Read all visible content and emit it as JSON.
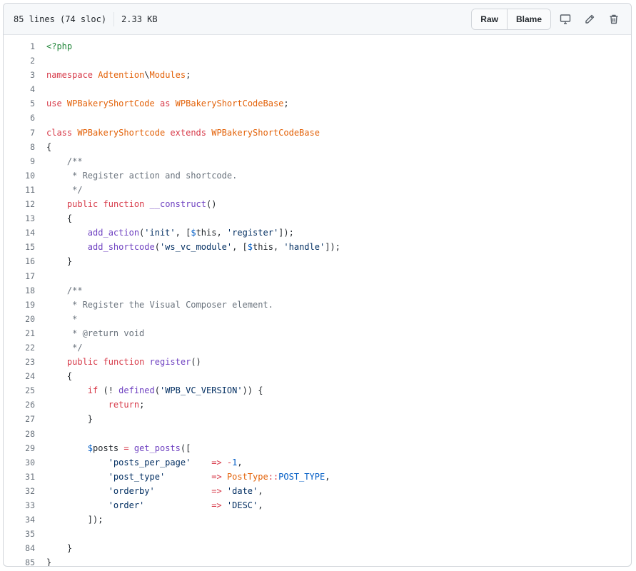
{
  "header": {
    "lines_info": "85 lines (74 sloc)",
    "size": "2.33 KB",
    "raw_label": "Raw",
    "blame_label": "Blame"
  },
  "icons": {
    "display": "desktop-icon",
    "edit": "pencil-icon",
    "delete": "trash-icon"
  },
  "code_lines": [
    {
      "n": "1",
      "t": [
        [
          "g",
          "<?php"
        ]
      ]
    },
    {
      "n": "2",
      "t": []
    },
    {
      "n": "3",
      "t": [
        [
          "k",
          "namespace"
        ],
        [
          "tx",
          " "
        ],
        [
          "e",
          "Adtention"
        ],
        [
          "tx",
          "\\"
        ],
        [
          "e",
          "Modules"
        ],
        [
          "tx",
          ";"
        ]
      ]
    },
    {
      "n": "4",
      "t": []
    },
    {
      "n": "5",
      "t": [
        [
          "k",
          "use"
        ],
        [
          "tx",
          " "
        ],
        [
          "e",
          "WPBakeryShortCode"
        ],
        [
          "tx",
          " "
        ],
        [
          "k",
          "as"
        ],
        [
          "tx",
          " "
        ],
        [
          "e",
          "WPBakeryShortCodeBase"
        ],
        [
          "tx",
          ";"
        ]
      ]
    },
    {
      "n": "6",
      "t": []
    },
    {
      "n": "7",
      "t": [
        [
          "k",
          "class"
        ],
        [
          "tx",
          " "
        ],
        [
          "e",
          "WPBakeryShortcode"
        ],
        [
          "tx",
          " "
        ],
        [
          "k",
          "extends"
        ],
        [
          "tx",
          " "
        ],
        [
          "e",
          "WPBakeryShortCodeBase"
        ]
      ]
    },
    {
      "n": "8",
      "t": [
        [
          "tx",
          "{"
        ]
      ]
    },
    {
      "n": "9",
      "t": [
        [
          "tx",
          "    "
        ],
        [
          "c",
          "/**"
        ]
      ]
    },
    {
      "n": "10",
      "t": [
        [
          "c",
          "     * Register action and shortcode."
        ]
      ]
    },
    {
      "n": "11",
      "t": [
        [
          "c",
          "     */"
        ]
      ]
    },
    {
      "n": "12",
      "t": [
        [
          "tx",
          "    "
        ],
        [
          "k",
          "public"
        ],
        [
          "tx",
          " "
        ],
        [
          "k",
          "function"
        ],
        [
          "tx",
          " "
        ],
        [
          "f",
          "__construct"
        ],
        [
          "tx",
          "()"
        ]
      ]
    },
    {
      "n": "13",
      "t": [
        [
          "tx",
          "    {"
        ]
      ]
    },
    {
      "n": "14",
      "t": [
        [
          "tx",
          "        "
        ],
        [
          "f",
          "add_action"
        ],
        [
          "tx",
          "("
        ],
        [
          "s",
          "'init'"
        ],
        [
          "tx",
          ", ["
        ],
        [
          "v",
          "$"
        ],
        [
          "tx",
          "this, "
        ],
        [
          "s",
          "'register'"
        ],
        [
          "tx",
          "]);"
        ]
      ]
    },
    {
      "n": "15",
      "t": [
        [
          "tx",
          "        "
        ],
        [
          "f",
          "add_shortcode"
        ],
        [
          "tx",
          "("
        ],
        [
          "s",
          "'ws_vc_module'"
        ],
        [
          "tx",
          ", ["
        ],
        [
          "v",
          "$"
        ],
        [
          "tx",
          "this, "
        ],
        [
          "s",
          "'handle'"
        ],
        [
          "tx",
          "]);"
        ]
      ]
    },
    {
      "n": "16",
      "t": [
        [
          "tx",
          "    }"
        ]
      ]
    },
    {
      "n": "17",
      "t": []
    },
    {
      "n": "18",
      "t": [
        [
          "tx",
          "    "
        ],
        [
          "c",
          "/**"
        ]
      ]
    },
    {
      "n": "19",
      "t": [
        [
          "c",
          "     * Register the Visual Composer element."
        ]
      ]
    },
    {
      "n": "20",
      "t": [
        [
          "c",
          "     *"
        ]
      ]
    },
    {
      "n": "21",
      "t": [
        [
          "c",
          "     * @return void"
        ]
      ]
    },
    {
      "n": "22",
      "t": [
        [
          "c",
          "     */"
        ]
      ]
    },
    {
      "n": "23",
      "t": [
        [
          "tx",
          "    "
        ],
        [
          "k",
          "public"
        ],
        [
          "tx",
          " "
        ],
        [
          "k",
          "function"
        ],
        [
          "tx",
          " "
        ],
        [
          "f",
          "register"
        ],
        [
          "tx",
          "()"
        ]
      ]
    },
    {
      "n": "24",
      "t": [
        [
          "tx",
          "    {"
        ]
      ]
    },
    {
      "n": "25",
      "t": [
        [
          "tx",
          "        "
        ],
        [
          "k",
          "if"
        ],
        [
          "tx",
          " (! "
        ],
        [
          "f",
          "defined"
        ],
        [
          "tx",
          "("
        ],
        [
          "s",
          "'WPB_VC_VERSION'"
        ],
        [
          "tx",
          ")) {"
        ]
      ]
    },
    {
      "n": "26",
      "t": [
        [
          "tx",
          "            "
        ],
        [
          "k",
          "return"
        ],
        [
          "tx",
          ";"
        ]
      ]
    },
    {
      "n": "27",
      "t": [
        [
          "tx",
          "        }"
        ]
      ]
    },
    {
      "n": "28",
      "t": []
    },
    {
      "n": "29",
      "t": [
        [
          "tx",
          "        "
        ],
        [
          "v",
          "$"
        ],
        [
          "tx",
          "posts "
        ],
        [
          "k",
          "="
        ],
        [
          "tx",
          " "
        ],
        [
          "f",
          "get_posts"
        ],
        [
          "tx",
          "(["
        ]
      ]
    },
    {
      "n": "30",
      "t": [
        [
          "tx",
          "            "
        ],
        [
          "s",
          "'posts_per_page'"
        ],
        [
          "tx",
          "    "
        ],
        [
          "k",
          "=>"
        ],
        [
          "tx",
          " "
        ],
        [
          "k",
          "-"
        ],
        [
          "v",
          "1"
        ],
        [
          "tx",
          ","
        ]
      ]
    },
    {
      "n": "31",
      "t": [
        [
          "tx",
          "            "
        ],
        [
          "s",
          "'post_type'"
        ],
        [
          "tx",
          "         "
        ],
        [
          "k",
          "=>"
        ],
        [
          "tx",
          " "
        ],
        [
          "e",
          "PostType"
        ],
        [
          "k",
          "::"
        ],
        [
          "v",
          "POST_TYPE"
        ],
        [
          "tx",
          ","
        ]
      ]
    },
    {
      "n": "32",
      "t": [
        [
          "tx",
          "            "
        ],
        [
          "s",
          "'orderby'"
        ],
        [
          "tx",
          "           "
        ],
        [
          "k",
          "=>"
        ],
        [
          "tx",
          " "
        ],
        [
          "s",
          "'date'"
        ],
        [
          "tx",
          ","
        ]
      ]
    },
    {
      "n": "33",
      "t": [
        [
          "tx",
          "            "
        ],
        [
          "s",
          "'order'"
        ],
        [
          "tx",
          "             "
        ],
        [
          "k",
          "=>"
        ],
        [
          "tx",
          " "
        ],
        [
          "s",
          "'DESC'"
        ],
        [
          "tx",
          ","
        ]
      ]
    },
    {
      "n": "34",
      "t": [
        [
          "tx",
          "        ]);"
        ]
      ]
    },
    {
      "n": "35",
      "t": []
    },
    {
      "n": "84",
      "t": [
        [
          "tx",
          "    }"
        ]
      ]
    },
    {
      "n": "85",
      "t": [
        [
          "tx",
          "}"
        ]
      ]
    }
  ]
}
